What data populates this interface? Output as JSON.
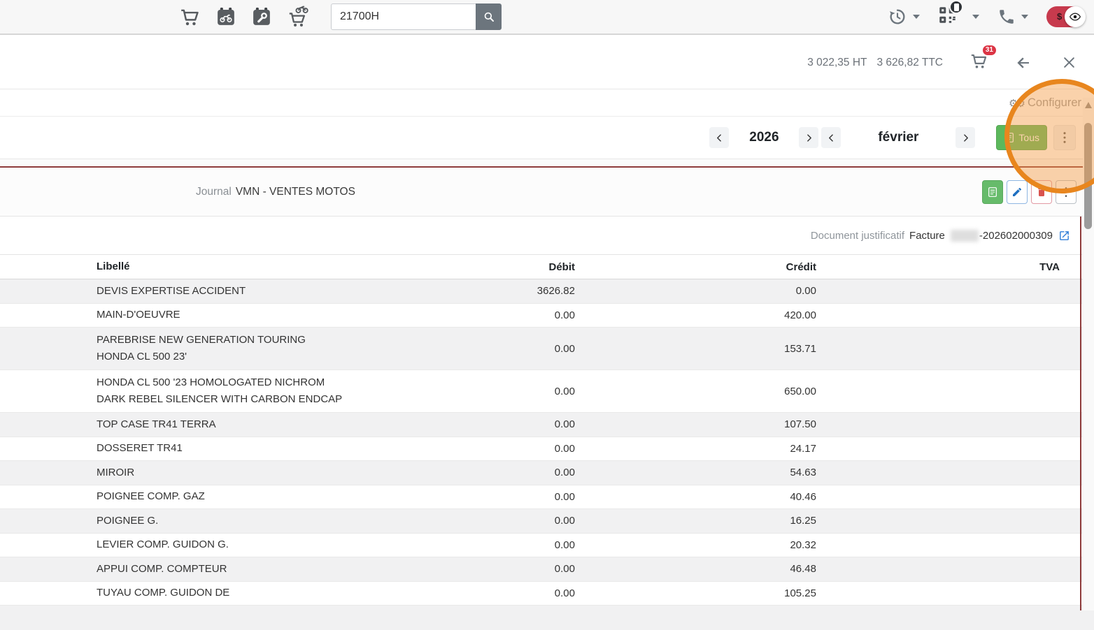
{
  "topbar": {
    "search": {
      "value": "21700H"
    },
    "currency_toggle_char": "$"
  },
  "summary": {
    "ht": "3 022,35 HT",
    "ttc": "3 626,82 TTC",
    "cart_count": "31"
  },
  "configure_label": "Configurer",
  "period": {
    "year": "2026",
    "month": "février",
    "all_label": "Tous"
  },
  "journal": {
    "label": "Journal",
    "name": "VMN - VENTES MOTOS"
  },
  "document": {
    "label": "Document justificatif",
    "type": "Facture",
    "number": "-202602000309"
  },
  "table": {
    "headers": {
      "libelle": "Libellé",
      "debit": "Débit",
      "credit": "Crédit",
      "tva": "TVA"
    },
    "rows": [
      {
        "libelle": "DEVIS EXPERTISE ACCIDENT",
        "libelle2": "",
        "debit": "3626.82",
        "credit": "0.00",
        "tva": ""
      },
      {
        "libelle": "MAIN-D'OEUVRE",
        "libelle2": "",
        "debit": "0.00",
        "credit": "420.00",
        "tva": ""
      },
      {
        "libelle": "PAREBRISE NEW GENERATION TOURING",
        "libelle2": "HONDA CL 500 23'",
        "debit": "0.00",
        "credit": "153.71",
        "tva": ""
      },
      {
        "libelle": "HONDA CL 500 '23 HOMOLOGATED NICHROM",
        "libelle2": "DARK REBEL SILENCER WITH CARBON ENDCAP",
        "debit": "0.00",
        "credit": "650.00",
        "tva": ""
      },
      {
        "libelle": "TOP CASE TR41 TERRA",
        "libelle2": "",
        "debit": "0.00",
        "credit": "107.50",
        "tva": ""
      },
      {
        "libelle": "DOSSERET TR41",
        "libelle2": "",
        "debit": "0.00",
        "credit": "24.17",
        "tva": ""
      },
      {
        "libelle": "MIROIR",
        "libelle2": "",
        "debit": "0.00",
        "credit": "54.63",
        "tva": ""
      },
      {
        "libelle": "POIGNEE COMP. GAZ",
        "libelle2": "",
        "debit": "0.00",
        "credit": "40.46",
        "tva": ""
      },
      {
        "libelle": "POIGNEE G.",
        "libelle2": "",
        "debit": "0.00",
        "credit": "16.25",
        "tva": ""
      },
      {
        "libelle": "LEVIER COMP. GUIDON G.",
        "libelle2": "",
        "debit": "0.00",
        "credit": "20.32",
        "tva": ""
      },
      {
        "libelle": "APPUI COMP. COMPTEUR",
        "libelle2": "",
        "debit": "0.00",
        "credit": "46.48",
        "tva": ""
      },
      {
        "libelle": "TUYAU COMP. GUIDON DE",
        "libelle2": "",
        "debit": "0.00",
        "credit": "105.25",
        "tva": ""
      }
    ]
  },
  "colors": {
    "accent_green": "#5cb85c",
    "accent_red": "#d9534f",
    "accent_blue": "#1e6fc0",
    "badge_red": "#dc3545",
    "toggle_red": "#c73a4d",
    "separator_maroon": "#8e3b3b",
    "annotation_orange": "#e8861e"
  }
}
